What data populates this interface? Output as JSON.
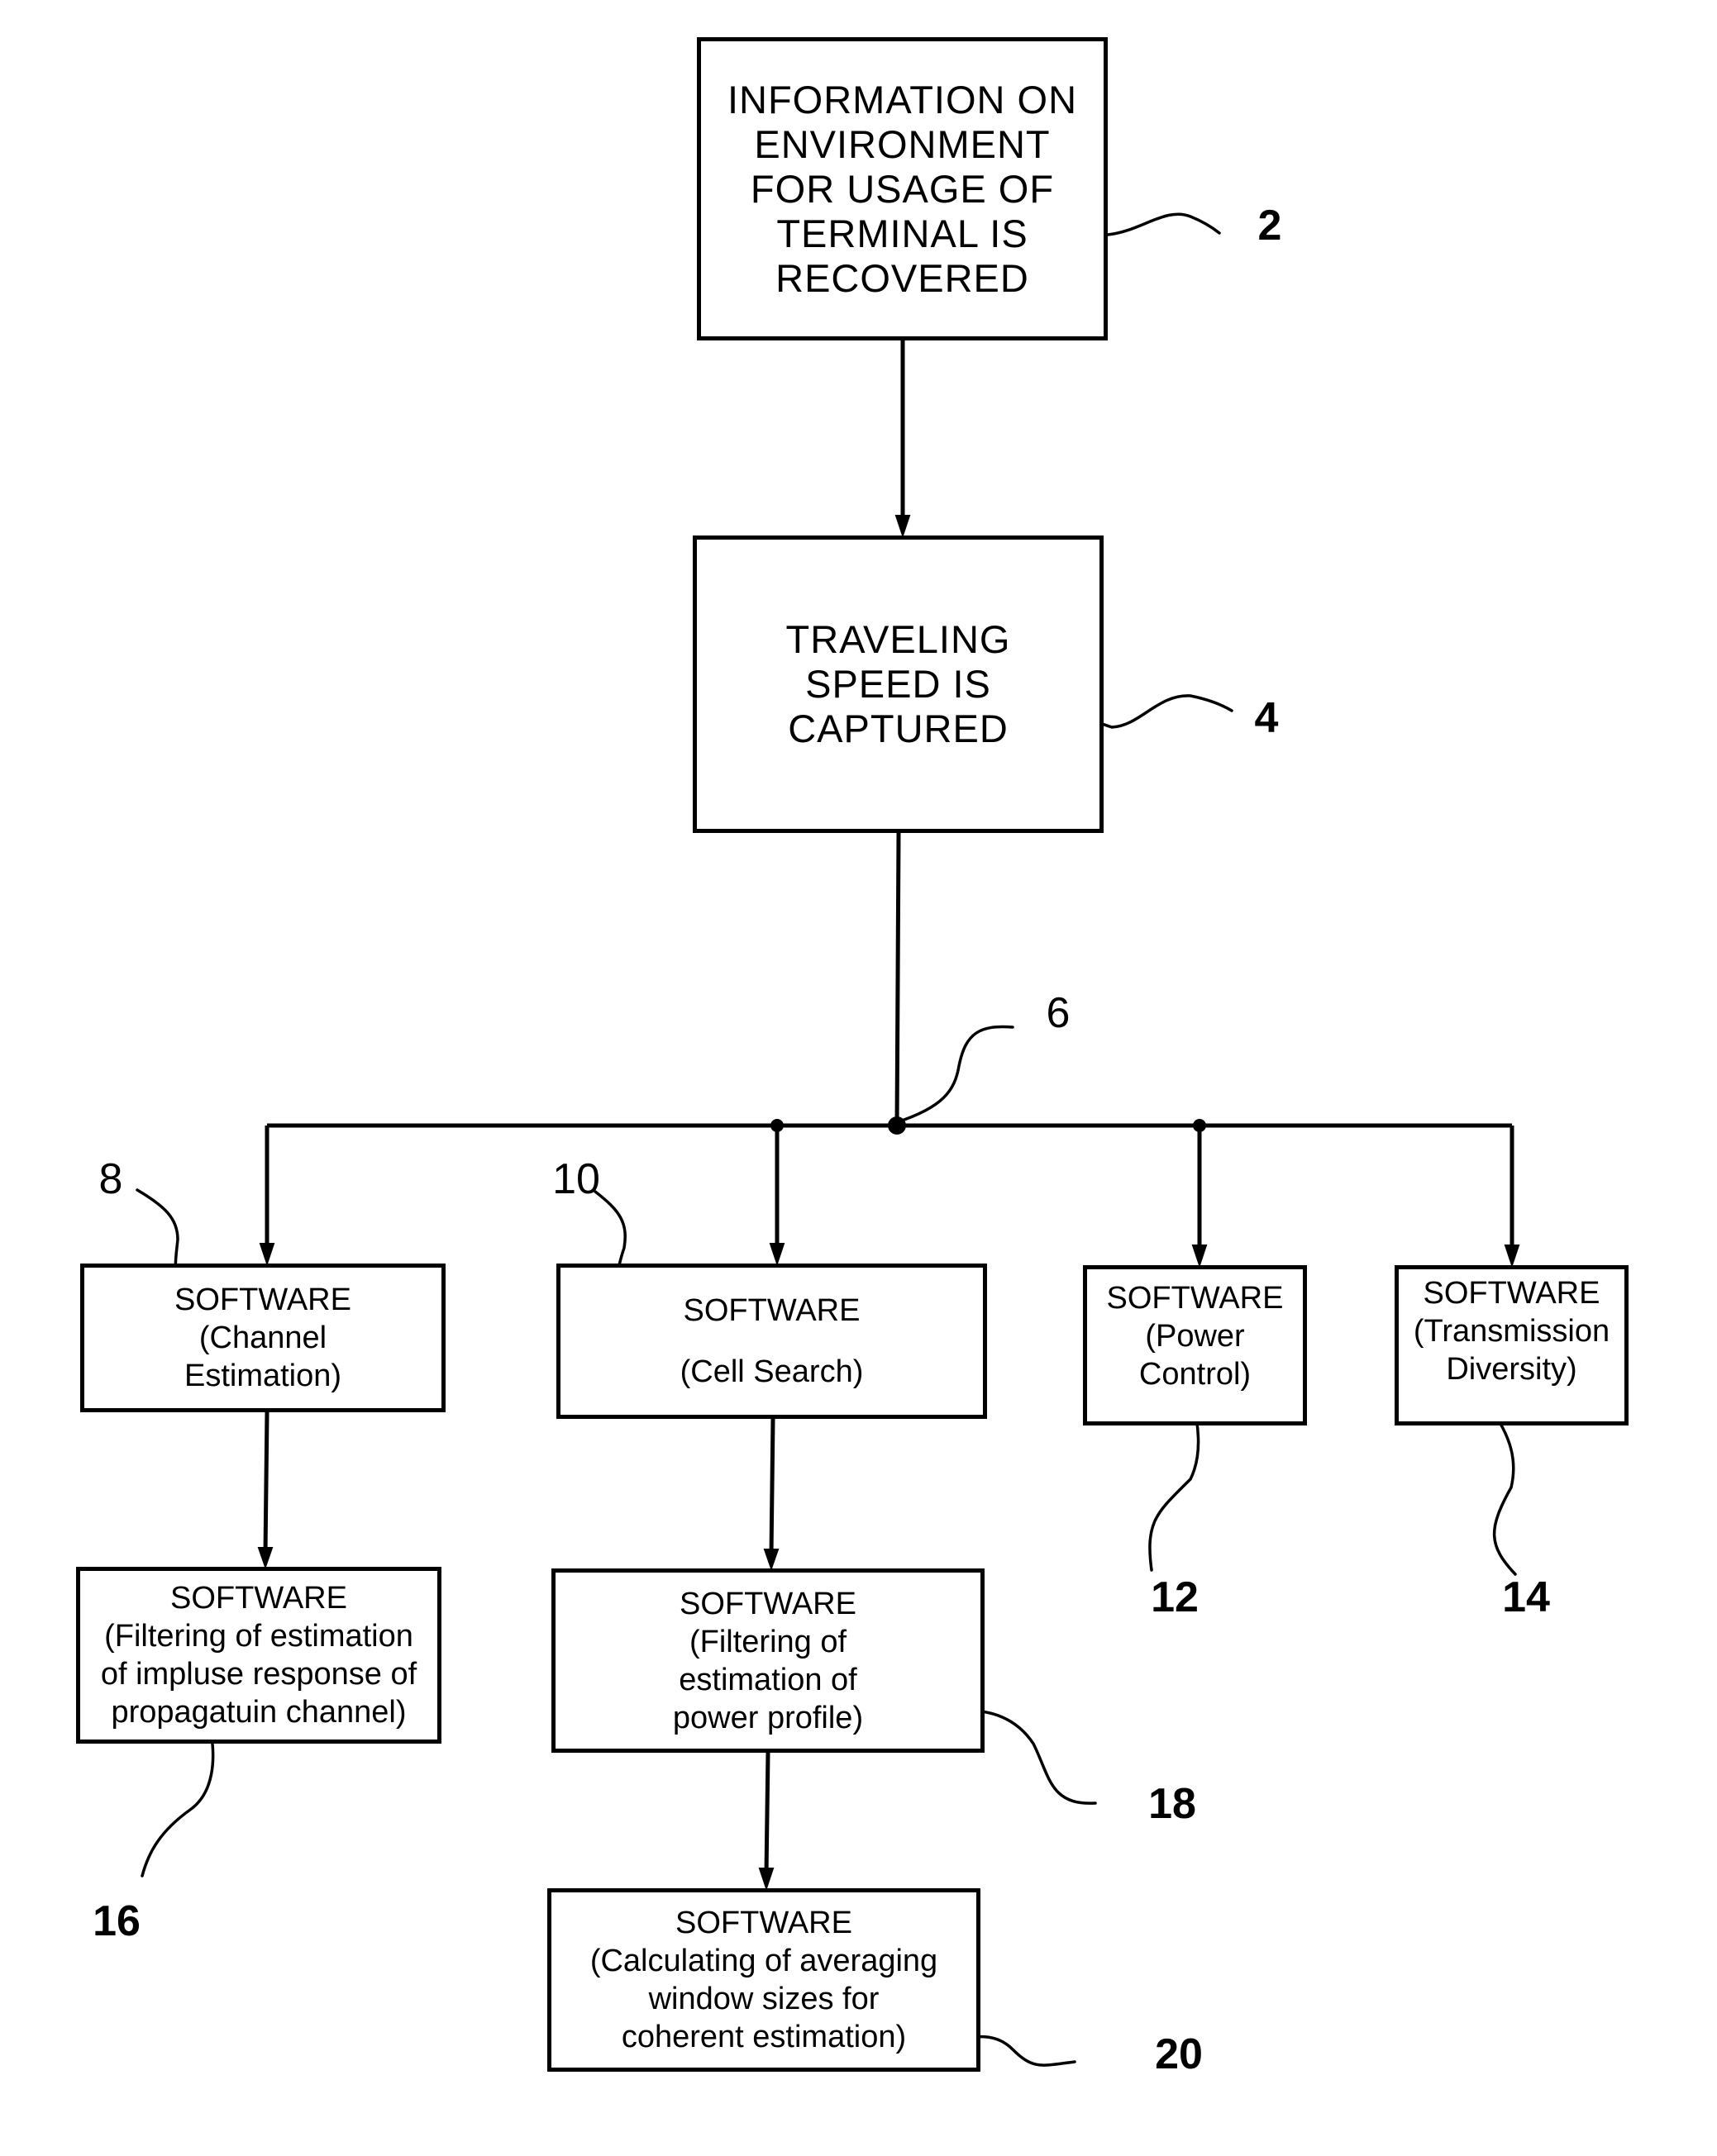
{
  "figure": {
    "boxes": [
      {
        "id": "2",
        "lines": [
          "INFORMATION ON",
          "ENVIRONMENT",
          "FOR USAGE OF",
          "TERMINAL IS",
          "RECOVERED"
        ]
      },
      {
        "id": "4",
        "lines": [
          "TRAVELING",
          "SPEED IS",
          "CAPTURED"
        ]
      },
      {
        "id": "8",
        "lines": [
          "SOFTWARE",
          "(Channel",
          "Estimation)"
        ]
      },
      {
        "id": "10",
        "lines": [
          "SOFTWARE",
          "(Cell Search)"
        ]
      },
      {
        "id": "12",
        "lines": [
          "SOFTWARE",
          "(Power",
          "Control)"
        ]
      },
      {
        "id": "14",
        "lines": [
          "SOFTWARE",
          "(Transmission",
          "Diversity)"
        ]
      },
      {
        "id": "16",
        "lines": [
          "SOFTWARE",
          "(Filtering of estimation",
          "of impluse response of",
          "propagatuin channel)"
        ]
      },
      {
        "id": "18",
        "lines": [
          "SOFTWARE",
          "(Filtering of",
          "estimation of",
          "power profile)"
        ]
      },
      {
        "id": "20",
        "lines": [
          "SOFTWARE",
          "(Calculating of averaging",
          "window sizes for",
          "coherent estimation)"
        ]
      }
    ],
    "reference_numerals": [
      "2",
      "4",
      "6",
      "8",
      "10",
      "12",
      "14",
      "16",
      "18",
      "20"
    ]
  }
}
